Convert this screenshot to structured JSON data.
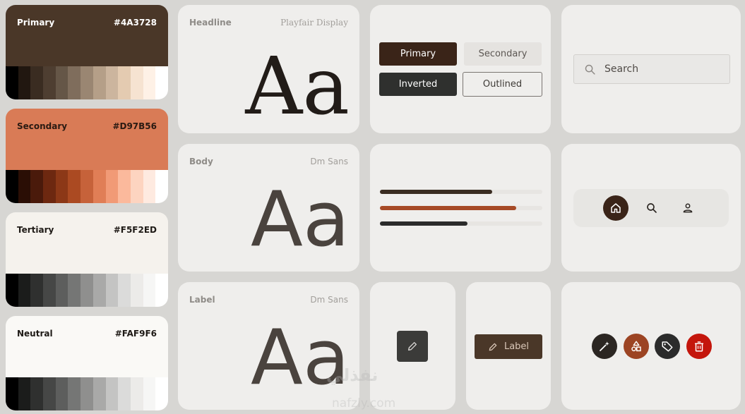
{
  "palette": [
    {
      "name": "Primary",
      "hex": "#4A3728",
      "base": "#4a3728",
      "text": "#ffffff",
      "steps": [
        "#000000",
        "#211710",
        "#3a2c21",
        "#4e3e31",
        "#655647",
        "#7f6d5c",
        "#9a8672",
        "#b59f88",
        "#ccb59e",
        "#e4cbb1",
        "#f6e3d1",
        "#fef1e6",
        "#ffffff"
      ]
    },
    {
      "name": "Secondary",
      "hex": "#D97B56",
      "base": "#d97b56",
      "text": "#2a1a12",
      "steps": [
        "#000000",
        "#2a0e05",
        "#4a1a0b",
        "#6d2810",
        "#8c3817",
        "#ab4a22",
        "#c6623a",
        "#e07e56",
        "#f19a76",
        "#fbb99c",
        "#fdd4c0",
        "#feeae0",
        "#ffffff"
      ]
    },
    {
      "name": "Tertiary",
      "hex": "#F5F2ED",
      "base": "#f5f2ed",
      "text": "#1e1a16",
      "steps": [
        "#000000",
        "#1b1c1b",
        "#2f302f",
        "#464746",
        "#5d5e5d",
        "#757675",
        "#8f8f8e",
        "#a9a9a8",
        "#c4c4c3",
        "#dbdbda",
        "#ecebe9",
        "#f6f6f5",
        "#ffffff"
      ]
    },
    {
      "name": "Neutral",
      "hex": "#FAF9F6",
      "base": "#faf9f6",
      "text": "#1e1a16",
      "steps": [
        "#000000",
        "#1b1c1b",
        "#2f302f",
        "#464746",
        "#5d5e5d",
        "#757675",
        "#8f8f8e",
        "#a9a9a8",
        "#c4c4c3",
        "#dbdbda",
        "#ecebe9",
        "#f6f6f5",
        "#ffffff"
      ]
    }
  ],
  "typography": {
    "headline": {
      "label": "Headline",
      "font": "Playfair Display",
      "sample": "Aa"
    },
    "body": {
      "label": "Body",
      "font": "Dm Sans",
      "sample": "Aa"
    },
    "label": {
      "label": "Label",
      "font": "Dm Sans",
      "sample": "Aa"
    }
  },
  "buttons": {
    "primary": "Primary",
    "secondary": "Secondary",
    "inverted": "Inverted",
    "outlined": "Outlined"
  },
  "search": {
    "placeholder": "Search"
  },
  "progress": [
    {
      "value": 0.69,
      "color": "#3a2c21"
    },
    {
      "value": 0.84,
      "color": "#a64a26"
    },
    {
      "value": 0.54,
      "color": "#2b2b2b"
    }
  ],
  "navbar": {
    "items": [
      "home-icon",
      "search-icon",
      "person-icon"
    ],
    "active": "home-icon"
  },
  "chips": {
    "label_button": "Label"
  },
  "fab_icons": [
    {
      "icon": "magic-wand-icon",
      "color": "#2b2622"
    },
    {
      "icon": "shapes-icon",
      "color": "#9c4423"
    },
    {
      "icon": "tag-icon",
      "color": "#2b2b2b"
    },
    {
      "icon": "trash-icon",
      "color": "#c4160c"
    }
  ],
  "colors": {
    "accent_dark": "#3a2c21",
    "accent_brown": "#4a3728"
  },
  "watermark": {
    "arabic": "نفذلي",
    "latin": "nafzly.com"
  }
}
